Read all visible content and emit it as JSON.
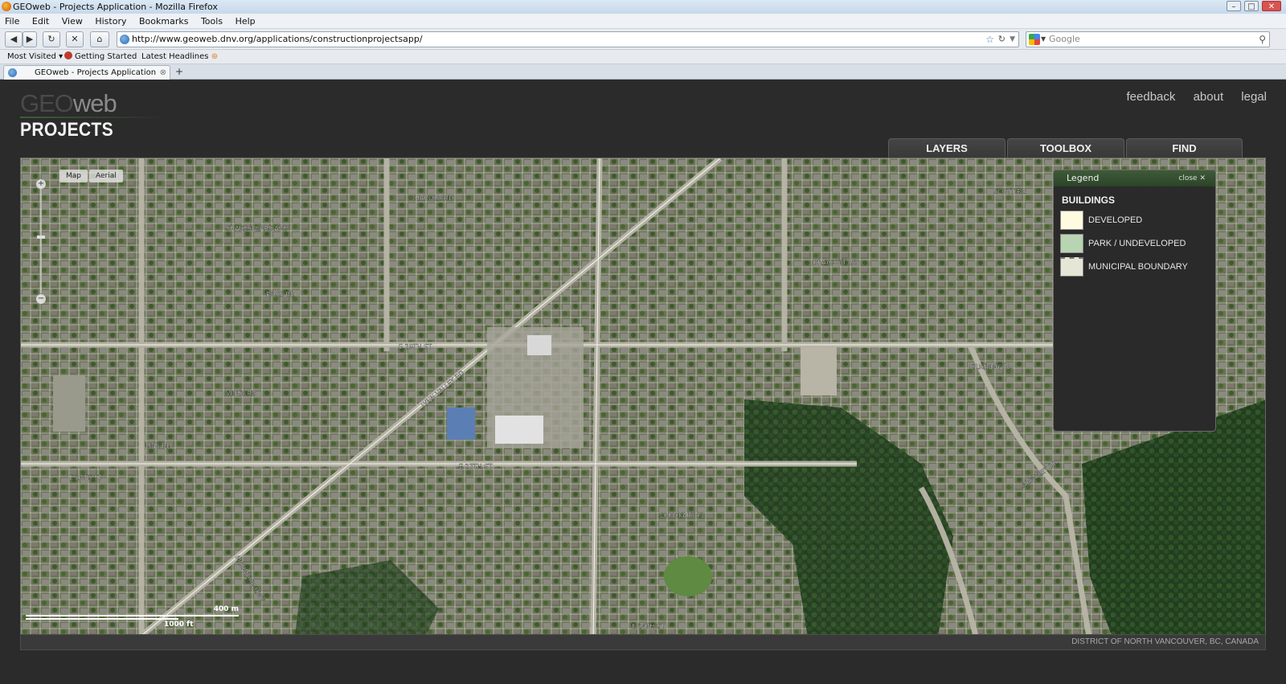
{
  "browser": {
    "window_title": "GEOweb - Projects Application - Mozilla Firefox",
    "menu": [
      "File",
      "Edit",
      "View",
      "History",
      "Bookmarks",
      "Tools",
      "Help"
    ],
    "url": "http://www.geoweb.dnv.org/applications/constructionprojectsapp/",
    "search_placeholder": "Google",
    "bookmarks": [
      "Most Visited",
      "Getting Started",
      "Latest Headlines"
    ],
    "tab_title": "GEOweb - Projects Application"
  },
  "app": {
    "logo_geo": "GEO",
    "logo_web": "web",
    "logo_projects": "PROJECTS",
    "top_links": [
      "feedback",
      "about",
      "legal"
    ],
    "tabs": [
      "LAYERS",
      "TOOLBOX",
      "FIND"
    ]
  },
  "map": {
    "map_type_buttons": [
      "Map",
      "Aerial"
    ],
    "scale_metric": "400 m",
    "scale_imperial": "1000 ft",
    "street_labels": [
      "HAROLD RD",
      "SHAKESPEARE AVE",
      "ROSS RD",
      "E 29TH ST",
      "LYNN VALLEY RD",
      "VINEY RD",
      "LINK RD",
      "E 28TH ST",
      "E 27TH ST",
      "DRAYCOTT RD",
      "KILKENNY RD",
      "E 24TH ST",
      "SCOTT RD",
      "CHUCKART PL",
      "WEMBLEY DR",
      "MOUNTAIN HWY"
    ]
  },
  "legend": {
    "header": "Legend",
    "close_label": "close ✕",
    "section_title": "BUILDINGS",
    "items": [
      {
        "label": "DEVELOPED",
        "color": "#fffbe0"
      },
      {
        "label": "PARK / UNDEVELOPED",
        "color": "#b9d4b3"
      },
      {
        "label": "MUNICIPAL BOUNDARY",
        "color": "#e6e6d6"
      }
    ]
  },
  "footer": {
    "text": "DISTRICT OF NORTH VANCOUVER, BC, CANADA"
  },
  "colors": {
    "accent_green": "#3e5a38",
    "background": "#2b2b2b"
  }
}
